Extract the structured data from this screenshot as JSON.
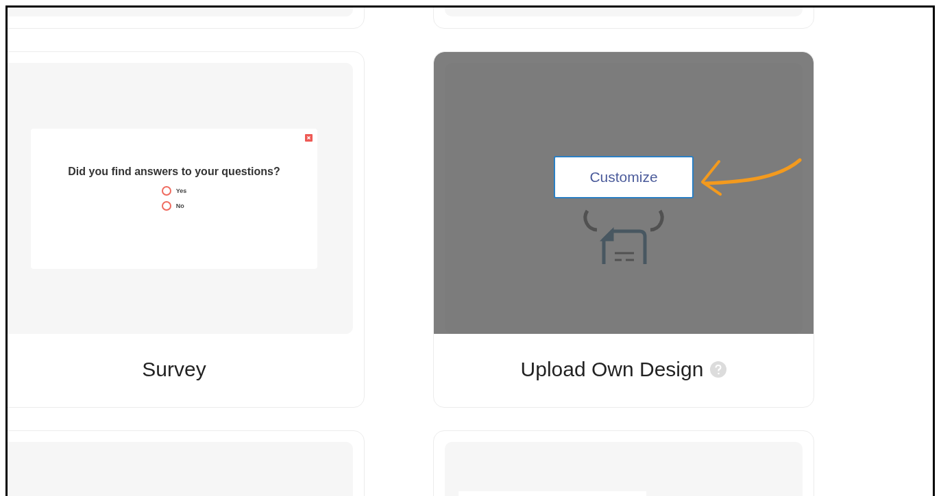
{
  "cards": [
    {
      "kind": "stub"
    },
    {
      "kind": "stub"
    },
    {
      "kind": "survey",
      "title": "Survey",
      "hovered": false,
      "question": "Did you find answers to your questions?",
      "options": [
        {
          "label": "Yes",
          "selected": false
        },
        {
          "label": "No",
          "selected": false
        }
      ]
    },
    {
      "kind": "upload",
      "title": "Upload Own Design",
      "hovered": true,
      "button": "Customize"
    },
    {
      "kind": "blank"
    },
    {
      "kind": "sheet"
    }
  ]
}
